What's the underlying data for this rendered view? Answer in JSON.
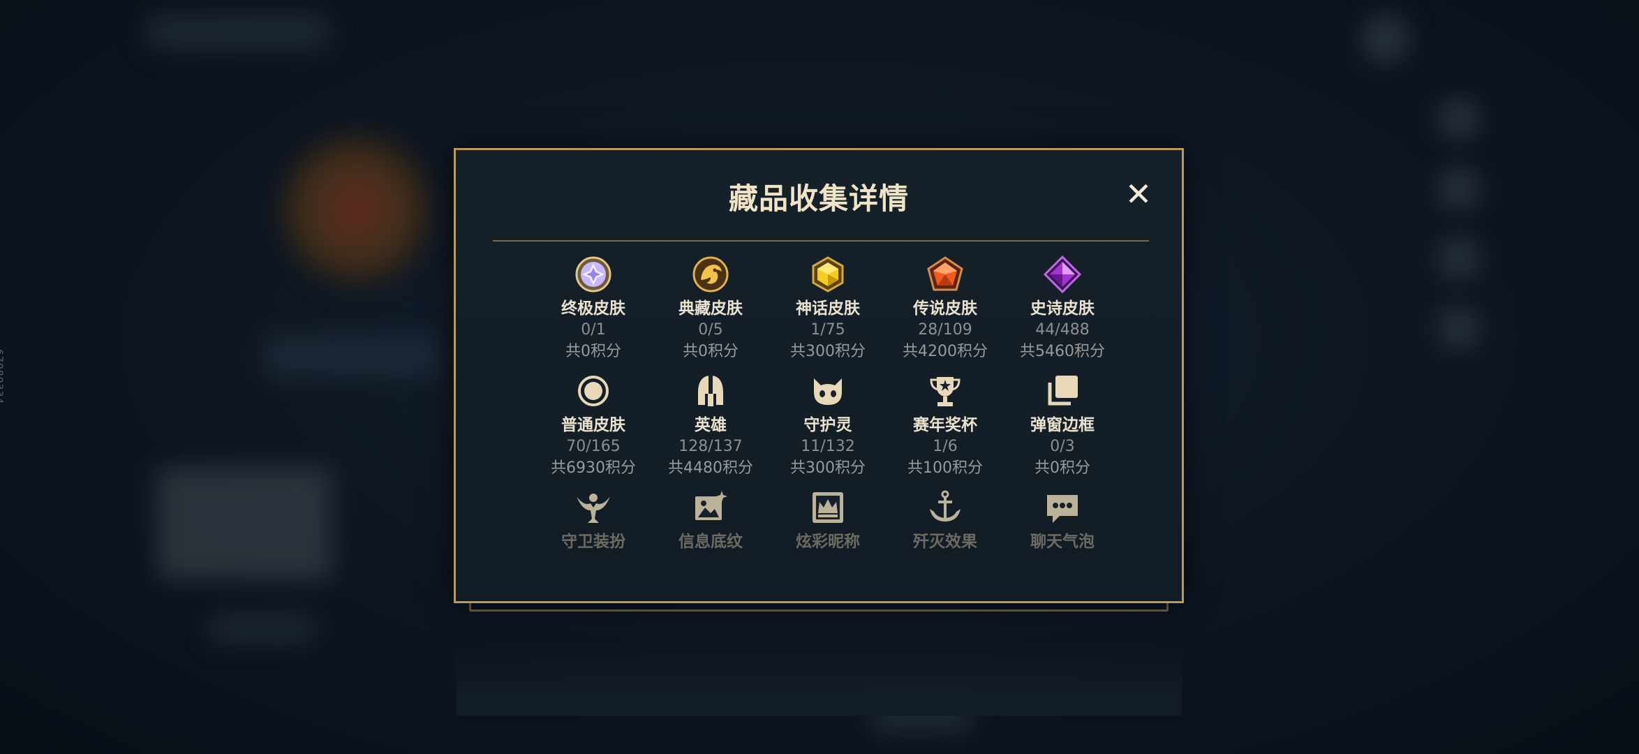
{
  "side_id": "67080334",
  "modal": {
    "title": "藏品收集详情",
    "close_label": "✕"
  },
  "items": [
    {
      "label": "终极皮肤",
      "count": "0/1",
      "points": "共0积分",
      "icon": "ultimate-gem-icon"
    },
    {
      "label": "典藏皮肤",
      "count": "0/5",
      "points": "共0积分",
      "icon": "collection-dragon-icon"
    },
    {
      "label": "神话皮肤",
      "count": "1/75",
      "points": "共300积分",
      "icon": "mythic-gem-icon"
    },
    {
      "label": "传说皮肤",
      "count": "28/109",
      "points": "共4200积分",
      "icon": "legendary-gem-icon"
    },
    {
      "label": "史诗皮肤",
      "count": "44/488",
      "points": "共5460积分",
      "icon": "epic-gem-icon"
    },
    {
      "label": "普通皮肤",
      "count": "70/165",
      "points": "共6930积分",
      "icon": "circle-icon"
    },
    {
      "label": "英雄",
      "count": "128/137",
      "points": "共4480积分",
      "icon": "helmet-icon"
    },
    {
      "label": "守护灵",
      "count": "11/132",
      "points": "共300积分",
      "icon": "companion-face-icon"
    },
    {
      "label": "赛年奖杯",
      "count": "1/6",
      "points": "共100积分",
      "icon": "trophy-icon"
    },
    {
      "label": "弹窗边框",
      "count": "0/3",
      "points": "共0积分",
      "icon": "stacked-frames-icon"
    },
    {
      "label": "守卫装扮",
      "count": "",
      "points": "",
      "icon": "ward-skin-icon"
    },
    {
      "label": "信息底纹",
      "count": "",
      "points": "",
      "icon": "banner-pattern-icon"
    },
    {
      "label": "炫彩昵称",
      "count": "",
      "points": "",
      "icon": "crown-nameplate-icon"
    },
    {
      "label": "歼灭效果",
      "count": "",
      "points": "",
      "icon": "anchor-icon"
    },
    {
      "label": "聊天气泡",
      "count": "",
      "points": "",
      "icon": "chat-bubble-icon"
    }
  ],
  "colors": {
    "frame_gold": "#b99a5c",
    "title": "#f1e3c5",
    "label": "#eae2cf",
    "muted": "#8f8f8f"
  }
}
